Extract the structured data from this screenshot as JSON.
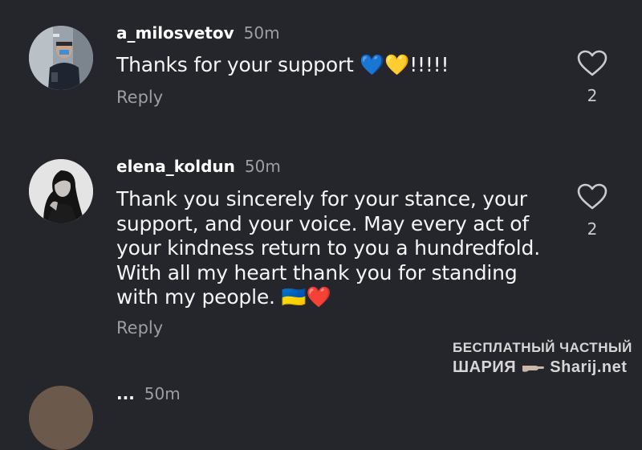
{
  "comments": [
    {
      "username": "a_milosvetov",
      "time": "50m",
      "text": "Thanks for your support",
      "emoji_suffix": "💙💛!!!!!",
      "reply_label": "Reply",
      "like_count": "2",
      "avatar_icon": "user-photo-avatar"
    },
    {
      "username": "elena_koldun",
      "time": "50m",
      "text_lines": [
        "Thank you sincerely for your stance, your",
        "support, and your voice. May every act of",
        "your kindness return to you a hundredfold.",
        "With all my heart thank you for standing",
        "with my people."
      ],
      "emoji_suffix": "🇺🇦❤️",
      "reply_label": "Reply",
      "like_count": "2",
      "avatar_icon": "user-photo-avatar"
    }
  ],
  "next_comment": {
    "username_partial": "...",
    "time": "50m"
  },
  "watermark": {
    "line1": "БЕСПЛАТНЫЙ ЧАСТНЫЙ",
    "line2_left": "ШАРИЯ",
    "line2_right": "Sharij.net"
  },
  "colors": {
    "background": "#25262b",
    "text": "#f5f5f5",
    "muted": "#9c9ea3"
  }
}
